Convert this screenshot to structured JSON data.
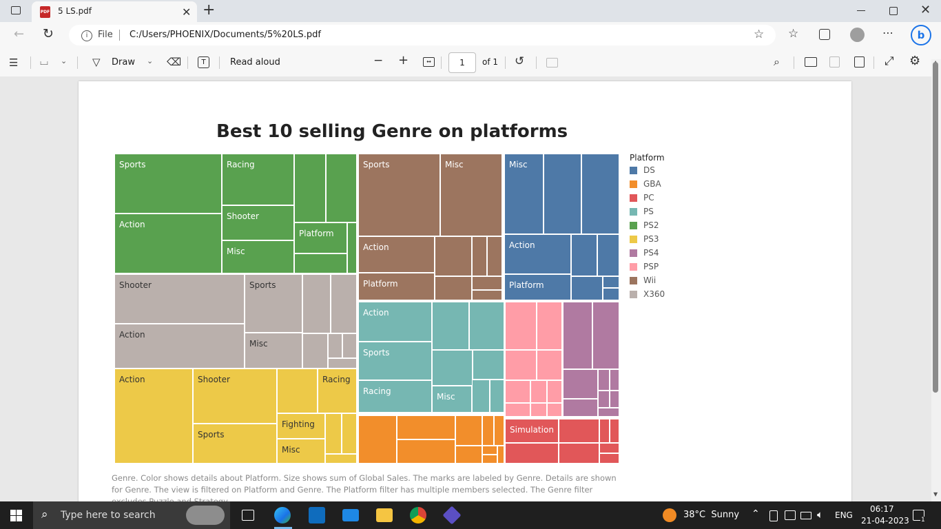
{
  "browser": {
    "tab_title": "5 LS.pdf",
    "tab_badge": "PDF",
    "address_prefix": "File",
    "url": "C:/Users/PHOENIX/Documents/5%20LS.pdf"
  },
  "pdf_toolbar": {
    "draw_label": "Draw",
    "read_aloud_label": "Read aloud",
    "page_number": "1",
    "page_of": "of 1"
  },
  "chart_data": {
    "type": "treemap",
    "title": "Best 10 selling Genre on platforms",
    "legend_title": "Platform",
    "legend": [
      {
        "name": "DS",
        "color": "#4e79a7"
      },
      {
        "name": "GBA",
        "color": "#f28e2b"
      },
      {
        "name": "PC",
        "color": "#e15759"
      },
      {
        "name": "PS",
        "color": "#76b7b2"
      },
      {
        "name": "PS2",
        "color": "#59a14f"
      },
      {
        "name": "PS3",
        "color": "#edc948"
      },
      {
        "name": "PS4",
        "color": "#b07aa1"
      },
      {
        "name": "PSP",
        "color": "#ff9da7"
      },
      {
        "name": "Wii",
        "color": "#9c755f"
      },
      {
        "name": "X360",
        "color": "#bab0ac"
      }
    ],
    "labeled_tiles": [
      {
        "platform": "PS2",
        "genre": "Sports"
      },
      {
        "platform": "PS2",
        "genre": "Racing"
      },
      {
        "platform": "PS2",
        "genre": "Action"
      },
      {
        "platform": "PS2",
        "genre": "Shooter"
      },
      {
        "platform": "PS2",
        "genre": "Platform"
      },
      {
        "platform": "PS2",
        "genre": "Misc"
      },
      {
        "platform": "Wii",
        "genre": "Sports"
      },
      {
        "platform": "Wii",
        "genre": "Misc"
      },
      {
        "platform": "Wii",
        "genre": "Action"
      },
      {
        "platform": "Wii",
        "genre": "Platform"
      },
      {
        "platform": "DS",
        "genre": "Misc"
      },
      {
        "platform": "DS",
        "genre": "Action"
      },
      {
        "platform": "DS",
        "genre": "Platform"
      },
      {
        "platform": "X360",
        "genre": "Shooter"
      },
      {
        "platform": "X360",
        "genre": "Sports"
      },
      {
        "platform": "X360",
        "genre": "Action"
      },
      {
        "platform": "X360",
        "genre": "Misc"
      },
      {
        "platform": "PS",
        "genre": "Action"
      },
      {
        "platform": "PS",
        "genre": "Sports"
      },
      {
        "platform": "PS",
        "genre": "Racing"
      },
      {
        "platform": "PS",
        "genre": "Misc"
      },
      {
        "platform": "PS3",
        "genre": "Action"
      },
      {
        "platform": "PS3",
        "genre": "Shooter"
      },
      {
        "platform": "PS3",
        "genre": "Racing"
      },
      {
        "platform": "PS3",
        "genre": "Sports"
      },
      {
        "platform": "PS3",
        "genre": "Fighting"
      },
      {
        "platform": "PS3",
        "genre": "Misc"
      },
      {
        "platform": "PC",
        "genre": "Simulation"
      }
    ],
    "caption": "Genre.  Color shows details about Platform.  Size shows sum of Global Sales.  The marks are labeled by Genre.  Details are shown for Genre. The view is filtered on Platform and Genre. The Platform filter has multiple members selected. The Genre filter excludes Puzzle and Strategy."
  },
  "taskbar": {
    "search_placeholder": "Type here to search",
    "weather": "38°C  Sunny",
    "language": "ENG",
    "time": "06:17",
    "date": "21-04-2023",
    "notification_count": "1"
  }
}
